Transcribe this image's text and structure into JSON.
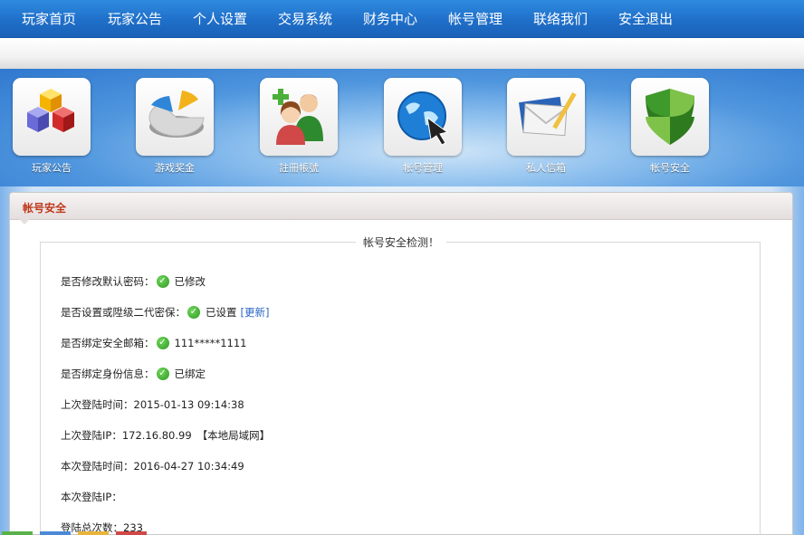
{
  "nav": {
    "items": [
      "玩家首页",
      "玩家公告",
      "个人设置",
      "交易系统",
      "财务中心",
      "帐号管理",
      "联络我们",
      "安全退出"
    ]
  },
  "tiles": [
    {
      "label": "玩家公告",
      "icon": "cubes-icon"
    },
    {
      "label": "游戏奖金",
      "icon": "pie-chart-icon"
    },
    {
      "label": "註冊帳號",
      "icon": "add-users-icon"
    },
    {
      "label": "帐号管理",
      "icon": "globe-cursor-icon"
    },
    {
      "label": "私人信箱",
      "icon": "mail-icon"
    },
    {
      "label": "帐号安全",
      "icon": "shield-icon"
    }
  ],
  "panel": {
    "title": "帐号安全",
    "legend": "帐号安全检测！"
  },
  "checks": {
    "password_label": "是否修改默认密码：",
    "password_value": "已修改",
    "secpass_label": "是否设置或陞级二代密保：",
    "secpass_value": "已设置",
    "secpass_link": "[更新]",
    "email_label": "是否绑定安全邮箱：",
    "email_value": "111*****1111",
    "identity_label": "是否绑定身份信息：",
    "identity_value": "已绑定"
  },
  "info": {
    "last_login_time_label": "上次登陆时间：",
    "last_login_time": "2015-01-13 09:14:38",
    "last_login_ip_label": "上次登陆IP：",
    "last_login_ip": "172.16.80.99",
    "last_login_ip_note": "【本地局域网】",
    "current_login_time_label": "本次登陆时间：",
    "current_login_time": "2016-04-27 10:34:49",
    "current_login_ip_label": "本次登陆IP：",
    "current_login_ip": "",
    "total_logins_label": "登陆总次数：",
    "total_logins": "233"
  },
  "colors": {
    "nav": "#1f6fc9",
    "panel_title": "#c0391b",
    "link": "#2a64c4",
    "check": "#2f9a23"
  }
}
